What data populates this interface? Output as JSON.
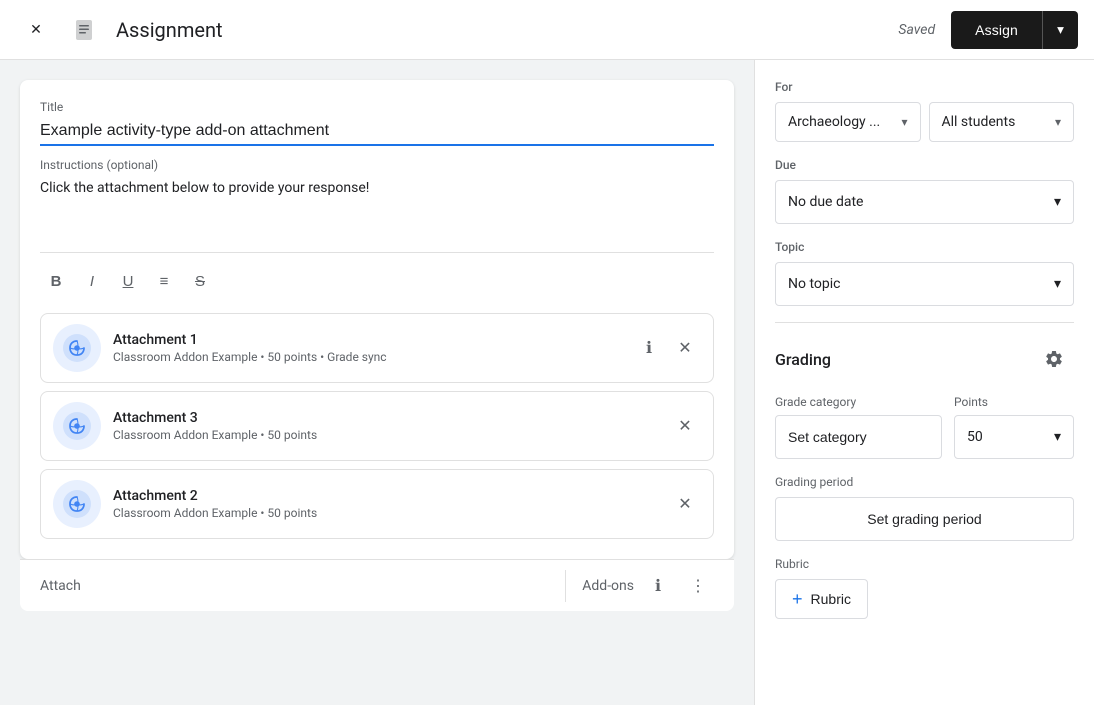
{
  "header": {
    "title": "Assignment",
    "saved_text": "Saved",
    "assign_label": "Assign",
    "close_icon": "✕",
    "doc_icon": "📄",
    "chevron_icon": "▾"
  },
  "content": {
    "title_label": "Title",
    "title_value": "Example activity-type add-on attachment",
    "instructions_label": "Instructions (optional)",
    "instructions_value": "Click the attachment below to provide your response!",
    "toolbar": {
      "bold": "B",
      "italic": "I",
      "underline": "U",
      "list": "≡",
      "strikethrough": "S̶"
    }
  },
  "attachments": [
    {
      "name": "Attachment 1",
      "meta": "Classroom Addon Example • 50 points • Grade sync"
    },
    {
      "name": "Attachment 3",
      "meta": "Classroom Addon Example • 50 points"
    },
    {
      "name": "Attachment 2",
      "meta": "Classroom Addon Example • 50 points"
    }
  ],
  "bottom_bar": {
    "attach_label": "Attach",
    "addons_label": "Add-ons"
  },
  "right_panel": {
    "for_label": "For",
    "class_value": "Archaeology ...",
    "students_value": "All students",
    "due_label": "Due",
    "due_value": "No due date",
    "topic_label": "Topic",
    "topic_value": "No topic",
    "grading_title": "Grading",
    "grade_category_label": "Grade category",
    "points_label": "Points",
    "set_category_label": "Set category",
    "points_value": "50",
    "grading_period_label": "Grading period",
    "set_grading_period_label": "Set grading period",
    "rubric_label": "Rubric",
    "add_rubric_label": "Rubric"
  }
}
